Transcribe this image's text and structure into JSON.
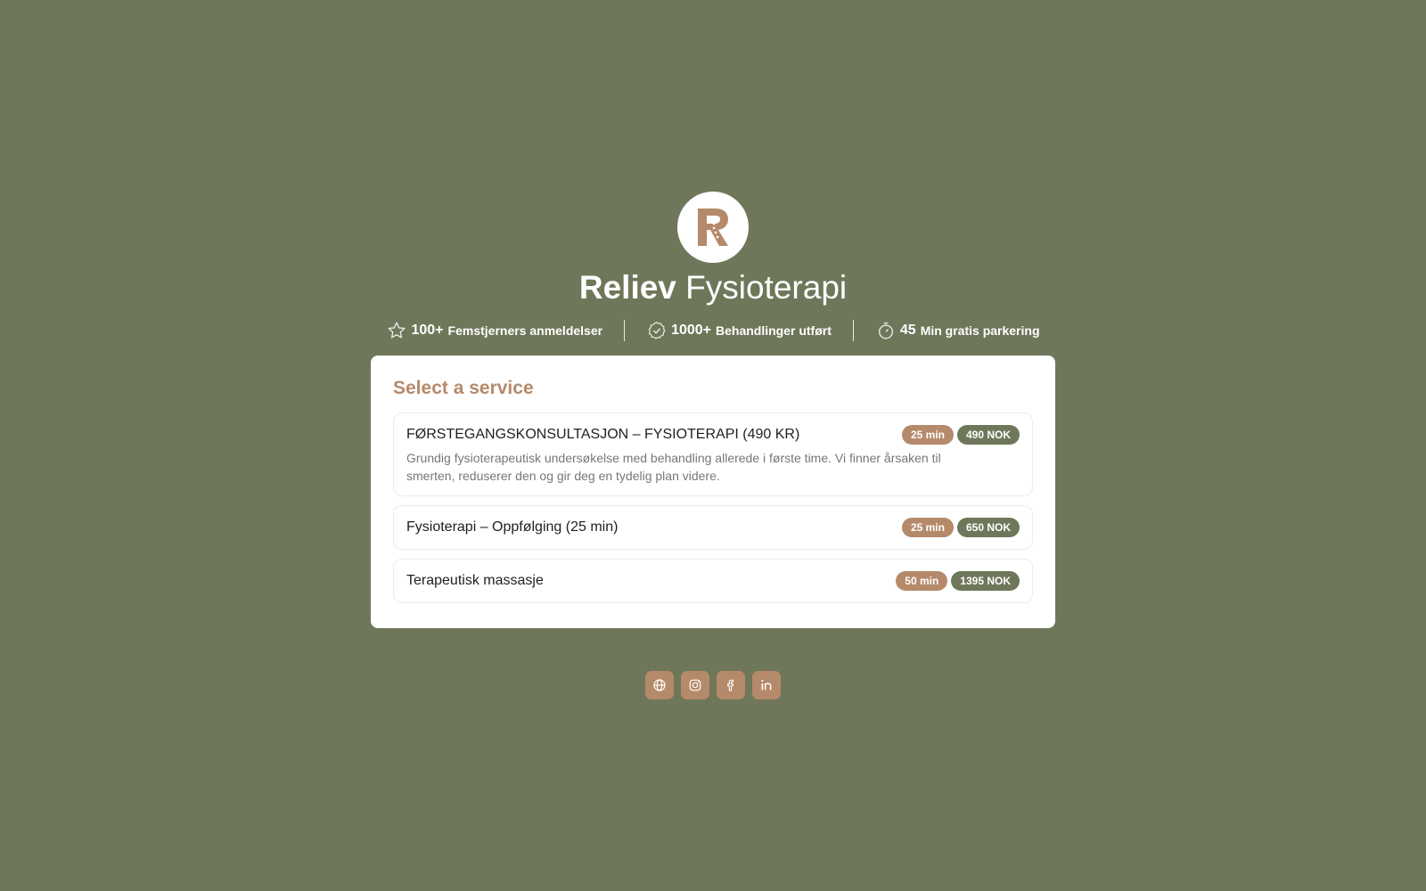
{
  "brand": {
    "logo_letter": "R",
    "name_bold": "Reliev",
    "name_regular": "Fysioterapi"
  },
  "stats": [
    {
      "icon": "star-icon",
      "number": "100+",
      "label": "Femstjerners anmeldelser"
    },
    {
      "icon": "check-badge-icon",
      "number": "1000+",
      "label": "Behandlinger utført"
    },
    {
      "icon": "stopwatch-icon",
      "number": "45",
      "label": "Min gratis parkering"
    }
  ],
  "card": {
    "title": "Select a service",
    "services": [
      {
        "name": "FØRSTEGANGSKONSULTASJON – FYSIOTERAPI (490 KR)",
        "duration": "25 min",
        "price": "490 NOK",
        "description": "Grundig fysioterapeutisk undersøkelse med behandling allerede i første time. Vi finner årsaken til smerten, reduserer den og gir deg en tydelig plan videre."
      },
      {
        "name": "Fysioterapi – Oppfølging (25 min)",
        "duration": "25 min",
        "price": "650 NOK"
      },
      {
        "name": "Terapeutisk massasje",
        "duration": "50 min",
        "price": "1395 NOK"
      }
    ]
  },
  "socials": [
    "globe-icon",
    "instagram-icon",
    "facebook-icon",
    "linkedin-icon"
  ],
  "colors": {
    "background": "#6f775a",
    "accent": "#b58a6a",
    "card": "#ffffff"
  }
}
